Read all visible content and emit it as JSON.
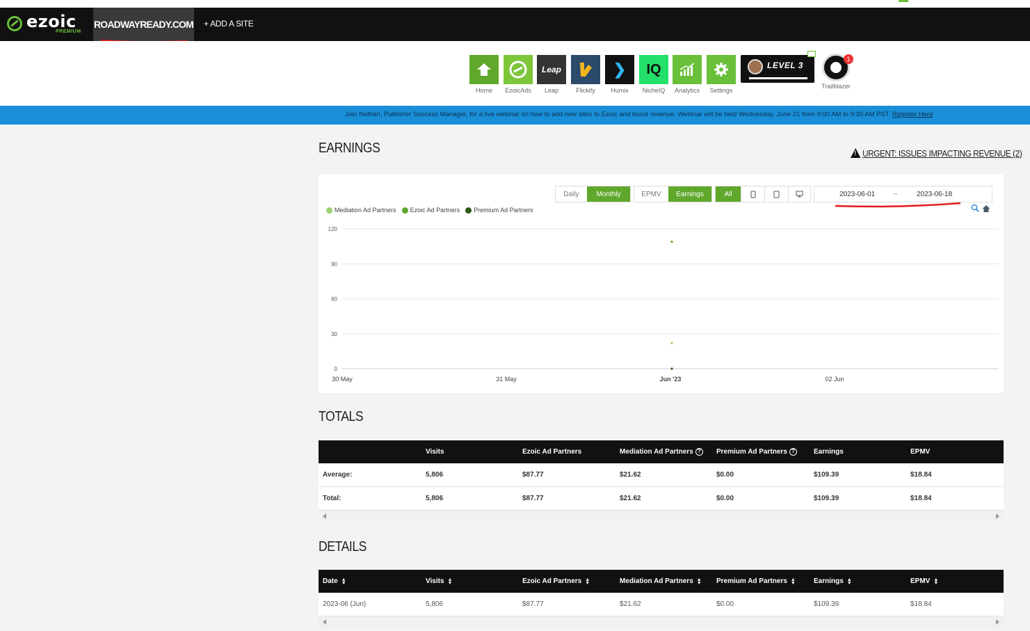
{
  "nav": {
    "logo_text": "ezoic",
    "logo_sub": "PREMIUM",
    "site": "ROADWAYREADY.COM",
    "add_site": "+ ADD A SITE"
  },
  "apps": [
    {
      "label": "Home",
      "color": "#5fa82b",
      "icon": "home-icon"
    },
    {
      "label": "EzoicAds",
      "color": "#7dc63a",
      "icon": "ezoic-ads-icon"
    },
    {
      "label": "Leap",
      "color": "#333333",
      "icon": "leap-icon",
      "glyph": "Leap"
    },
    {
      "label": "Flickify",
      "color": "#2c4a6a",
      "icon": "flickify-icon"
    },
    {
      "label": "Humix",
      "color": "#111111",
      "icon": "humix-icon",
      "glyph": "❯"
    },
    {
      "label": "NicheIQ",
      "color": "#22e06a",
      "icon": "nicheiq-icon",
      "glyph": "IQ"
    },
    {
      "label": "Analytics",
      "color": "#6abf3a",
      "icon": "analytics-icon"
    },
    {
      "label": "Settings",
      "color": "#6abf3a",
      "icon": "gear-icon"
    }
  ],
  "level": {
    "text": "LEVEL 3"
  },
  "trailblazer": {
    "label": "Trailblazer",
    "badge": "1"
  },
  "banner": {
    "text": "Join Nathan, Publisher Success Manager, for a live webinar on how to add new sites to Ezoic and boost revenue. Webinar will be held Wednesday, June 21 from 9:00 AM to 9:30 AM PST.",
    "link": "Register Here"
  },
  "earnings": {
    "title": "EARNINGS",
    "urgent": "URGENT: ISSUES IMPACTING REVENUE (2)",
    "granularity": [
      "Daily",
      "Monthly"
    ],
    "metric": [
      "EPMV",
      "Earnings"
    ],
    "device": [
      "All"
    ],
    "date_from": "2023-06-01",
    "date_sep": "~",
    "date_to": "2023-06-18",
    "legend": [
      {
        "name": "Mediation Ad Partners",
        "color": "#9cd070"
      },
      {
        "name": "Ezoic Ad Partners",
        "color": "#5fa82b"
      },
      {
        "name": "Premium Ad Partners",
        "color": "#2d5a14"
      }
    ]
  },
  "chart_data": {
    "type": "scatter",
    "x": [
      "30 May",
      "31 May",
      "Jun '23",
      "02 Jun"
    ],
    "ylim": [
      0,
      120
    ],
    "yticks": [
      0,
      30,
      60,
      90,
      120
    ],
    "series": [
      {
        "name": "Ezoic Ad Partners",
        "x": "Jun '23",
        "y": 109,
        "color": "#5fa82b"
      },
      {
        "name": "Mediation Ad Partners",
        "x": "Jun '23",
        "y": 22,
        "color": "#9cd070"
      },
      {
        "name": "Premium Ad Partners",
        "x": "Jun '23",
        "y": 0,
        "color": "#2d5a14"
      }
    ]
  },
  "totals": {
    "title": "TOTALS",
    "headers": [
      "",
      "Visits",
      "Ezoic Ad Partners",
      "Mediation Ad Partners",
      "Premium Ad Partners",
      "Earnings",
      "EPMV"
    ],
    "rows": [
      [
        "Average:",
        "5,806",
        "$87.77",
        "$21.62",
        "$0.00",
        "$109.39",
        "$18.84"
      ],
      [
        "Total:",
        "5,806",
        "$87.77",
        "$21.62",
        "$0.00",
        "$109.39",
        "$18.84"
      ]
    ]
  },
  "details": {
    "title": "DETAILS",
    "headers": [
      "Date",
      "Visits",
      "Ezoic Ad Partners",
      "Mediation Ad Partners",
      "Premium Ad Partners",
      "Earnings",
      "EPMV"
    ],
    "rows": [
      [
        "2023-06 (Jun)",
        "5,806",
        "$87.77",
        "$21.62",
        "$0.00",
        "$109.39",
        "$18.84"
      ]
    ]
  }
}
